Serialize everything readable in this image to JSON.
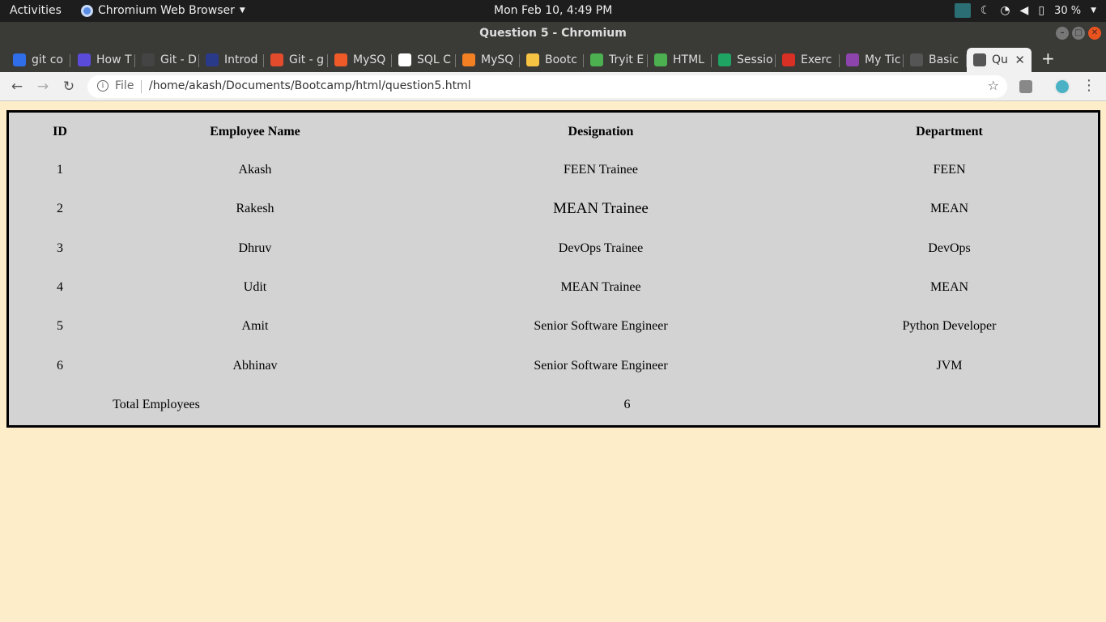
{
  "topbar": {
    "activities": "Activities",
    "app_name": "Chromium Web Browser",
    "clock": "Mon Feb 10,  4:49 PM",
    "battery": "30 %"
  },
  "window": {
    "title": "Question 5 - Chromium"
  },
  "tabs": [
    {
      "label": "git co",
      "color": "#2f6ee8"
    },
    {
      "label": "How T",
      "color": "#5b4bdb"
    },
    {
      "label": "Git - D",
      "color": "#444444"
    },
    {
      "label": "Introd",
      "color": "#2a3a8a"
    },
    {
      "label": "Git - g",
      "color": "#e24c2c"
    },
    {
      "label": "MySQ",
      "color": "#f05a28"
    },
    {
      "label": "SQL C",
      "color": "#ffffff"
    },
    {
      "label": "MySQ",
      "color": "#f48024"
    },
    {
      "label": "Bootc",
      "color": "#f6c343"
    },
    {
      "label": "Tryit E",
      "color": "#4caf50"
    },
    {
      "label": "HTML",
      "color": "#4caf50"
    },
    {
      "label": "Sessio",
      "color": "#1fa463"
    },
    {
      "label": "Exerc",
      "color": "#d93025"
    },
    {
      "label": "My Tic",
      "color": "#8e44ad"
    },
    {
      "label": "Basic",
      "color": "#555555"
    },
    {
      "label": "Qu",
      "color": "#555555",
      "active": true
    }
  ],
  "address_bar": {
    "scheme_label": "File",
    "url": "/home/akash/Documents/Bootcamp/html/question5.html"
  },
  "employee_table": {
    "headers": [
      "ID",
      "Employee Name",
      "Designation",
      "Department"
    ],
    "rows": [
      [
        "1",
        "Akash",
        "FEEN Trainee",
        "FEEN"
      ],
      [
        "2",
        "Rakesh",
        "MEAN Trainee",
        "MEAN"
      ],
      [
        "3",
        "Dhruv",
        "DevOps Trainee",
        "DevOps"
      ],
      [
        "4",
        "Udit",
        "MEAN Trainee",
        "MEAN"
      ],
      [
        "5",
        "Amit",
        "Senior Software Engineer",
        "Python Developer"
      ],
      [
        "6",
        "Abhinav",
        "Senior Software Engineer",
        "JVM"
      ]
    ],
    "footer": {
      "label": "Total Employees",
      "value": "6"
    }
  }
}
